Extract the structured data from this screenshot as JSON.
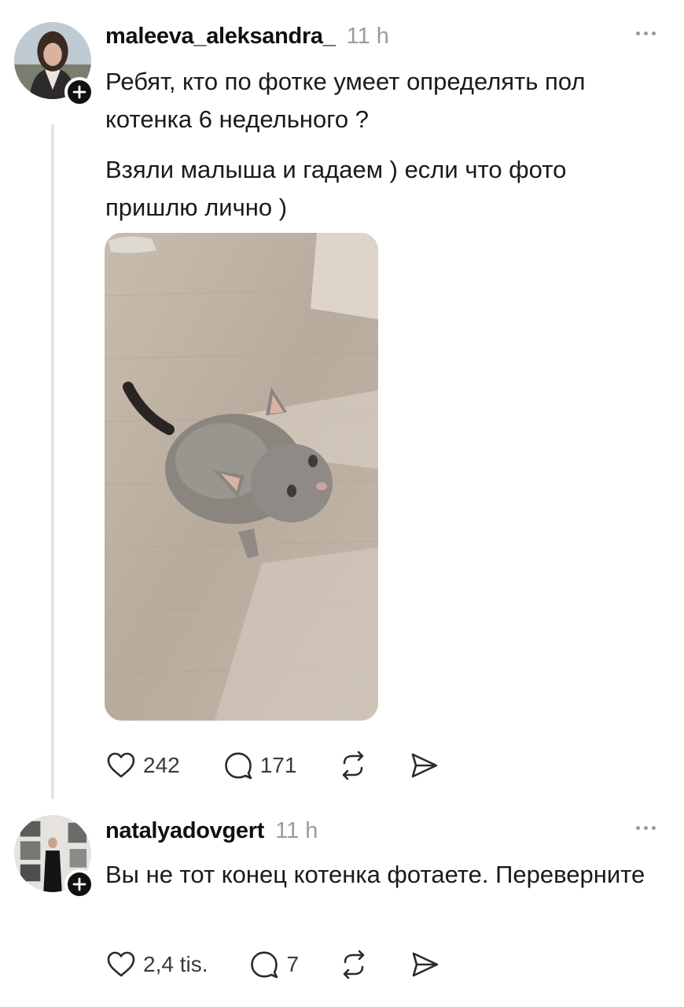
{
  "posts": [
    {
      "username": "maleeva_aleksandra_",
      "time": "11 h",
      "paragraphs": [
        "Ребят, кто по фотке умеет определять пол котенка 6 недельного ?",
        "Взяли малыша и гадаем ) если что фото пришлю лично )"
      ],
      "likes": "242",
      "replies": "171"
    },
    {
      "username": "natalyadovgert",
      "time": "11 h",
      "paragraphs": [
        "Вы не тот конец котенка фотаете. Переверните"
      ],
      "likes": "2,4 tis.",
      "replies": "7"
    }
  ],
  "icons": {
    "like": "heart-icon",
    "reply": "comment-icon",
    "repost": "repost-icon",
    "share": "send-icon",
    "more": "more-dots-icon",
    "follow": "plus-icon"
  },
  "colors": {
    "text": "#101010",
    "muted": "#9b9b9b",
    "thread_line": "#e4e4e4",
    "badge": "#111111"
  }
}
